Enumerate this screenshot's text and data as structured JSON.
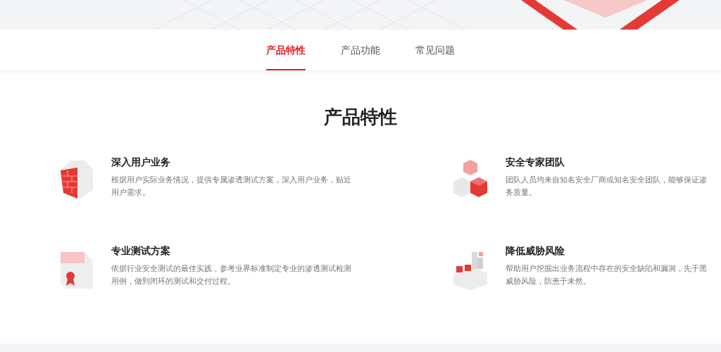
{
  "tabs": [
    {
      "label": "产品特性",
      "selected": true
    },
    {
      "label": "产品功能",
      "selected": false
    },
    {
      "label": "常见问题",
      "selected": false
    }
  ],
  "section_title": "产品特性",
  "features": [
    {
      "kind": "shield",
      "title": "深入用户业务",
      "description_lines": [
        "根据用户实际业务情况，提供专属渗透测试方案，深入用户业务，贴近",
        "用户需求。"
      ]
    },
    {
      "kind": "cubes",
      "title": "安全专家团队",
      "description_lines": [
        "团队人员均来自知名安全厂商或知名安全团队，能够保证渗",
        "务质量。"
      ]
    },
    {
      "kind": "certificate",
      "title": "专业测试方案",
      "description_lines": [
        "依据行业安全测试的最佳实践，参考业界标准制定专业的渗透测试检测",
        "用例，做到闭环的测试和交付过程。"
      ]
    },
    {
      "kind": "blocks",
      "title": "降低威胁风险",
      "description_lines": [
        "帮助用户挖掘出业务流程中存在的安全缺陷和漏洞，先于黑",
        "威胁风险，防患于未然。"
      ]
    }
  ]
}
